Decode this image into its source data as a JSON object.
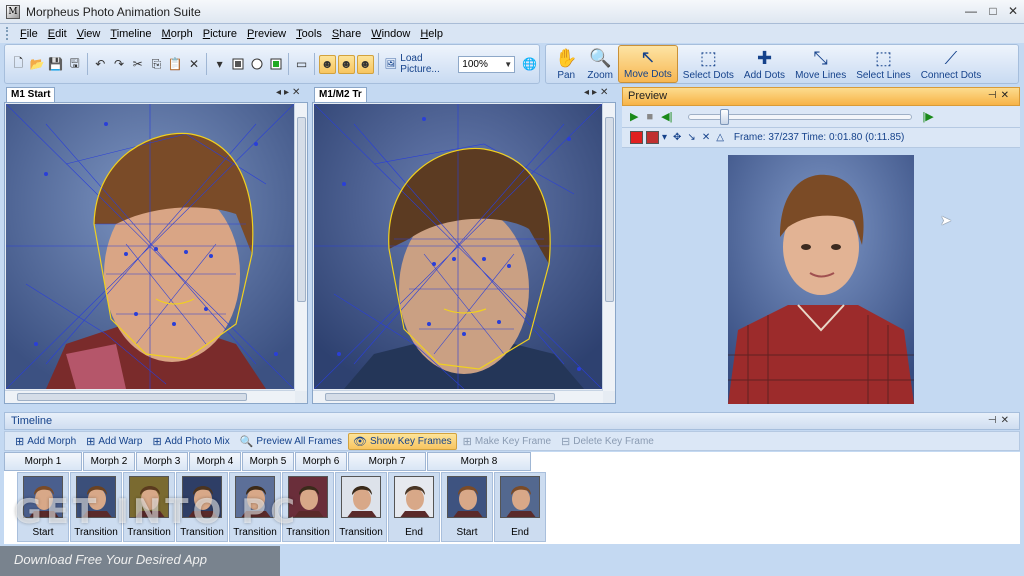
{
  "window": {
    "title": "Morpheus Photo Animation Suite",
    "icon_letter": "M",
    "controls": [
      "—",
      "□",
      "✕"
    ]
  },
  "menu": [
    "File",
    "Edit",
    "View",
    "Timeline",
    "Morph",
    "Picture",
    "Preview",
    "Tools",
    "Share",
    "Window",
    "Help"
  ],
  "toolbar": {
    "load_picture_label": "Load Picture...",
    "zoom_value": "100%",
    "buttons": [
      {
        "name": "new-icon",
        "glyph": "🗋"
      },
      {
        "name": "open-icon",
        "glyph": "📂"
      },
      {
        "name": "save-icon",
        "glyph": "💾"
      },
      {
        "name": "save-all-icon",
        "glyph": "🖫"
      },
      {
        "name": "undo-icon",
        "glyph": "↶"
      },
      {
        "name": "redo-icon",
        "glyph": "↷"
      },
      {
        "name": "cut-icon",
        "glyph": "✂"
      },
      {
        "name": "copy-icon",
        "glyph": "⎘"
      },
      {
        "name": "paste-icon",
        "glyph": "📋"
      },
      {
        "name": "delete-icon",
        "glyph": "✕"
      }
    ]
  },
  "tools": [
    {
      "label": "Pan",
      "glyph": "✋"
    },
    {
      "label": "Zoom",
      "glyph": "🔍"
    },
    {
      "label": "Move Dots",
      "glyph": "↖"
    },
    {
      "label": "Select Dots",
      "glyph": "⬚"
    },
    {
      "label": "Add Dots",
      "glyph": "✚"
    },
    {
      "label": "Move Lines",
      "glyph": "⤡"
    },
    {
      "label": "Select Lines",
      "glyph": "⬚"
    },
    {
      "label": "Connect Dots",
      "glyph": "⟋"
    }
  ],
  "active_tool": "Move Dots",
  "docs": [
    {
      "tab": "M1 Start"
    },
    {
      "tab": "M1/M2 Tr"
    }
  ],
  "preview": {
    "title": "Preview",
    "frame_text": "Frame: 37/237  Time: 0:01.80 (0:11.85)",
    "progress": 0.156
  },
  "timeline": {
    "title": "Timeline",
    "buttons": [
      {
        "label": "Add Morph",
        "state": "normal",
        "glyph": "⊞"
      },
      {
        "label": "Add Warp",
        "state": "normal",
        "glyph": "⊞"
      },
      {
        "label": "Add Photo Mix",
        "state": "normal",
        "glyph": "⊞"
      },
      {
        "label": "Preview All Frames",
        "state": "normal",
        "glyph": "🔍"
      },
      {
        "label": "Show Key Frames",
        "state": "active",
        "glyph": "👁"
      },
      {
        "label": "Make Key Frame",
        "state": "disabled",
        "glyph": "⊞"
      },
      {
        "label": "Delete Key Frame",
        "state": "disabled",
        "glyph": "⊟"
      }
    ],
    "morphs": [
      "Morph 1",
      "Morph 2",
      "Morph 3",
      "Morph 4",
      "Morph 5",
      "Morph 6",
      "Morph 7",
      "Morph 8"
    ],
    "frames": [
      "Start",
      "Transition",
      "Transition",
      "Transition",
      "Transition",
      "Transition",
      "Transition",
      "End",
      "Start",
      "End"
    ]
  },
  "watermark": {
    "brand": "GET INTO PC",
    "tagline": "Download Free Your Desired App"
  },
  "colors": {
    "accent": "#f7b752",
    "panel": "#c4d9f2",
    "mesh": "#2a3fd8",
    "outline": "#f0d020"
  }
}
